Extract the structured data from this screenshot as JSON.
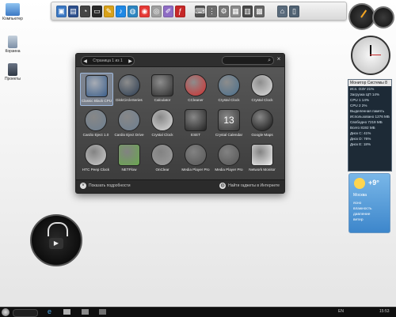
{
  "desktop": {
    "icons": [
      {
        "label": "Компьютер",
        "icon": "computer-icon",
        "color": "#4a90d9"
      },
      {
        "label": "Корзина",
        "icon": "recycle-bin-icon",
        "color": "#7c8fa6"
      },
      {
        "label": "Проекты",
        "icon": "folder-icon",
        "color": "#3c4656"
      }
    ]
  },
  "dock": {
    "items": [
      {
        "icon": "computer-icon",
        "color": "#3b78c4"
      },
      {
        "icon": "film-icon",
        "color": "#2d4f8c"
      },
      {
        "icon": "gauge-icon",
        "color": "#444444"
      },
      {
        "icon": "monitor-icon",
        "color": "#2a2a2a"
      },
      {
        "icon": "notepad-icon",
        "color": "#d8a11a"
      },
      {
        "icon": "music-icon",
        "color": "#1e88e5"
      },
      {
        "icon": "globe-icon",
        "color": "#2e86c1"
      },
      {
        "icon": "chrome-icon",
        "color": "#e53935"
      },
      {
        "icon": "cd-icon",
        "color": "#9e9e9e"
      },
      {
        "icon": "paint-icon",
        "color": "#8e6cc4"
      },
      {
        "icon": "flash-icon",
        "color": "#c62828"
      },
      {
        "icon": "keyboard-icon",
        "color": "#555555"
      },
      {
        "icon": "network-icon",
        "color": "#6d6d6d"
      },
      {
        "icon": "settings-icon",
        "color": "#777777"
      },
      {
        "icon": "calculator-icon",
        "color": "#8a8a8a"
      },
      {
        "icon": "chart-icon",
        "color": "#4a4a4a"
      },
      {
        "icon": "grid-icon",
        "color": "#666666"
      },
      {
        "icon": "home-icon",
        "color": "#5a6b7c"
      },
      {
        "icon": "trash-icon",
        "color": "#4f6172"
      }
    ]
  },
  "gadget_window": {
    "pager": {
      "text": "Страница 1 из 1"
    },
    "search_placeholder": "",
    "gadgets": [
      {
        "label": "Classic Black CPU",
        "icon": "cpu-meter-icon",
        "color": "#3b5e8a"
      },
      {
        "label": "DiskCircleSeries",
        "icon": "disk-icon",
        "color": "#2a3b50"
      },
      {
        "label": "Calculator",
        "icon": "calculator-icon",
        "color": "#2e2e2e"
      },
      {
        "label": "CCleaner",
        "icon": "ccleaner-icon",
        "color": "#d32f2f"
      },
      {
        "label": "Crystal Clock",
        "icon": "clock-icon",
        "color": "#4a6f8c"
      },
      {
        "label": "Crystal Clock",
        "icon": "clock-icon",
        "color": "#e0e0e0"
      },
      {
        "label": "Cardio Eject 1.0",
        "icon": "eject-icon",
        "color": "#6d7f91"
      },
      {
        "label": "Cardio Eject Drive",
        "icon": "eject-icon",
        "color": "#6d7f91"
      },
      {
        "label": "Crystal Clock",
        "icon": "clock-icon",
        "color": "#dddddd"
      },
      {
        "label": "ESET",
        "icon": "eset-icon",
        "color": "#222222"
      },
      {
        "label": "Crystal Calendar",
        "icon": "calendar-icon",
        "color": "#3a3a3a"
      },
      {
        "label": "Google Maps",
        "icon": "globe-icon",
        "color": "#111111"
      },
      {
        "label": "HTC Peep Clock",
        "icon": "clock-icon",
        "color": "#cfcfcf"
      },
      {
        "label": "NETFlow",
        "icon": "folder-icon",
        "color": "#6aa84f"
      },
      {
        "label": "OnClear",
        "icon": "clock-icon",
        "color": "#9e9e9e"
      },
      {
        "label": "Media Player Pro",
        "icon": "headphones-icon",
        "color": "#555555"
      },
      {
        "label": "Media Player Pro",
        "icon": "headphones-icon",
        "color": "#555555"
      },
      {
        "label": "Network Monitor",
        "icon": "network-icon",
        "color": "#f2f2f2"
      }
    ],
    "calendar_day": "13",
    "footer_left": "Показать подробности",
    "footer_right": "Найти гаджеты в Интернете"
  },
  "sysmon": {
    "title": "Монитор Системы 8",
    "rows": [
      "Исп. ОЗУ 21%",
      "Загрузка ЦП 14%",
      "CPU 1 14%",
      "CPU 2 2%",
      "Выделенная память",
      "Использовано 1276 МБ",
      "Свободно 7219 МБ",
      "Всего 8192 МБ",
      "Диск C: 41%",
      "Диск D: 76%",
      "Диск E: 18%"
    ]
  },
  "weather": {
    "temp": "+9°",
    "city": "Москва",
    "rows": [
      "ясно",
      "влажность",
      "давление",
      "ветер"
    ]
  },
  "taskbar": {
    "lang": "EN",
    "time": "15:53"
  }
}
